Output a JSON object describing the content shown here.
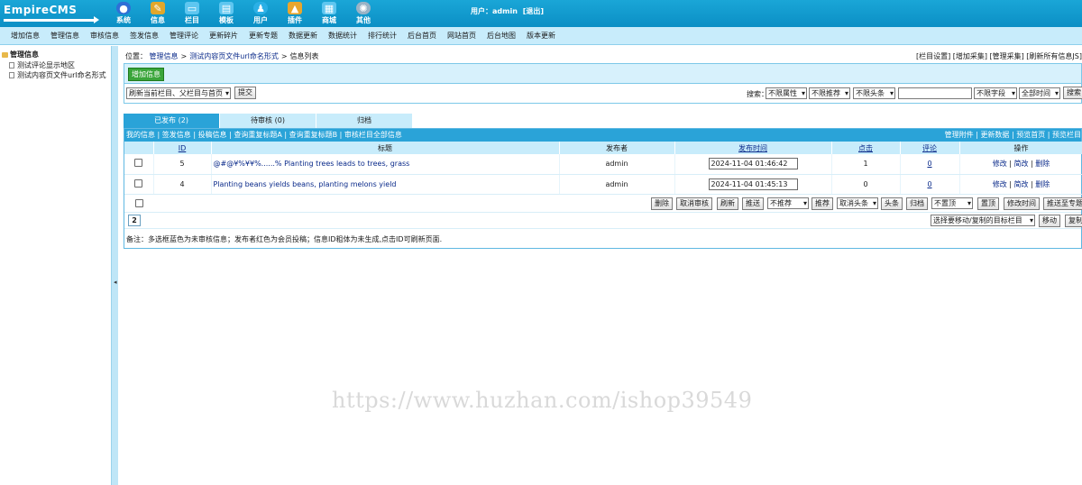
{
  "brand": {
    "logo_text": "EmpireCMS"
  },
  "topnav": [
    {
      "label": "系统",
      "icon": "globe-icon",
      "color": "#2f6fd6"
    },
    {
      "label": "信息",
      "icon": "pencil-icon",
      "color": "#e1a72b"
    },
    {
      "label": "栏目",
      "icon": "folder-icon",
      "color": "#5ec6f0"
    },
    {
      "label": "模板",
      "icon": "template-icon",
      "color": "#5ec6f0"
    },
    {
      "label": "用户",
      "icon": "user-icon",
      "color": "#2bb0e6"
    },
    {
      "label": "插件",
      "icon": "plugin-icon",
      "color": "#e9a62d"
    },
    {
      "label": "商城",
      "icon": "shop-icon",
      "color": "#5ec6f0"
    },
    {
      "label": "其他",
      "icon": "gear-icon",
      "color": "#9ab3c6"
    }
  ],
  "user": {
    "prefix": "用户：",
    "name": "admin",
    "logout": "[退出]"
  },
  "subnav": [
    "增加信息",
    "管理信息",
    "审核信息",
    "签发信息",
    "管理评论",
    "更新碎片",
    "更新专题",
    "数据更新",
    "数据统计",
    "排行统计",
    "后台首页",
    "网站首页",
    "后台地图",
    "版本更新"
  ],
  "tree": {
    "root": "管理信息",
    "nodes": [
      "测试评论显示地区",
      "测试内容页文件url命名形式"
    ]
  },
  "breadcrumb": {
    "label": "位置：",
    "parts": [
      "管理信息",
      "测试内容页文件url命名形式",
      "信息列表"
    ],
    "sep": ">"
  },
  "toplinks": "[栏目设置] [增加采集] [管理采集] [刷新所有信息JS]",
  "add_button": "增加信息",
  "filter": {
    "refresh_select": "刷新当前栏目、父栏目与首页",
    "submit": "提交",
    "search_label": "搜索：",
    "attr_select": "不限属性",
    "recommend_select": "不限推荐",
    "headline_select": "不限头条",
    "search_value": "",
    "field_select": "不限字段",
    "time_select": "全部时间",
    "search_button": "搜索"
  },
  "tabs": [
    "已发布 (2)",
    "待审核 (0)",
    "归档"
  ],
  "list_links_left": [
    "我的信息",
    "签发信息",
    "投稿信息",
    "查询重复标题A",
    "查询重复标题B",
    "审核栏目全部信息"
  ],
  "list_links_right": [
    "管理附件",
    "更新数据",
    "预览首页",
    "预览栏目"
  ],
  "columns": {
    "id": "ID",
    "title": "标题",
    "publisher": "发布者",
    "time": "发布时间",
    "clicks": "点击",
    "comments": "评论",
    "ops": "操作"
  },
  "rows": [
    {
      "id": "5",
      "title": "@#@¥%¥¥%......% Planting trees leads to trees, grass",
      "publisher": "admin",
      "time": "2024-11-04 01:46:42",
      "clicks": "1",
      "comments": "0",
      "ops": [
        "修改",
        "简改",
        "删除"
      ]
    },
    {
      "id": "4",
      "title": "Planting beans yields beans, planting melons yield",
      "publisher": "admin",
      "time": "2024-11-04 01:45:13",
      "clicks": "0",
      "comments": "0",
      "ops": [
        "修改",
        "简改",
        "删除"
      ]
    }
  ],
  "toolbar": {
    "delete": "删除",
    "unaudit": "取消审核",
    "refresh": "刷新",
    "push": "推送",
    "recommend_select": "不推荐",
    "recommend": "推荐",
    "headline_select": "取消头条",
    "headline": "头条",
    "archive": "归档",
    "top_select": "不置顶",
    "top": "置顶",
    "modtime": "修改时间",
    "push_special": "推送至专题"
  },
  "pagerow": {
    "page": "2",
    "move_select": "选择要移动/复制的目标栏目",
    "move": "移动",
    "copy": "复制"
  },
  "note": "备注：多选框蓝色为未审核信息；发布者红色为会员投稿；信息ID粗体为未生成,点击ID可刷新页面.",
  "watermark": "https://www.huzhan.com/ishop39549"
}
